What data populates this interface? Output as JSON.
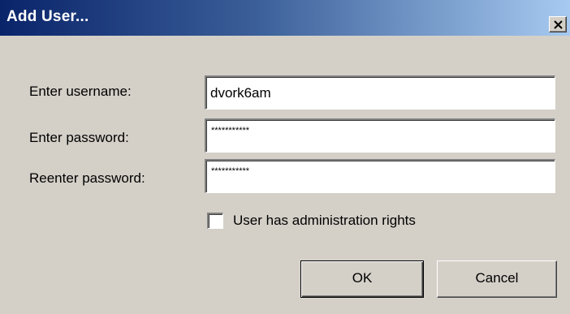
{
  "window": {
    "title": "Add User...",
    "close_icon": "close-icon"
  },
  "form": {
    "username_label": "Enter username:",
    "username_value": "dvork6am",
    "password_label": "Enter password:",
    "password_mask": "***********",
    "reenter_label": "Reenter password:",
    "reenter_mask": "***********",
    "admin_checkbox_label": "User has administration rights",
    "admin_checked": false
  },
  "buttons": {
    "ok_label": "OK",
    "cancel_label": "Cancel"
  }
}
